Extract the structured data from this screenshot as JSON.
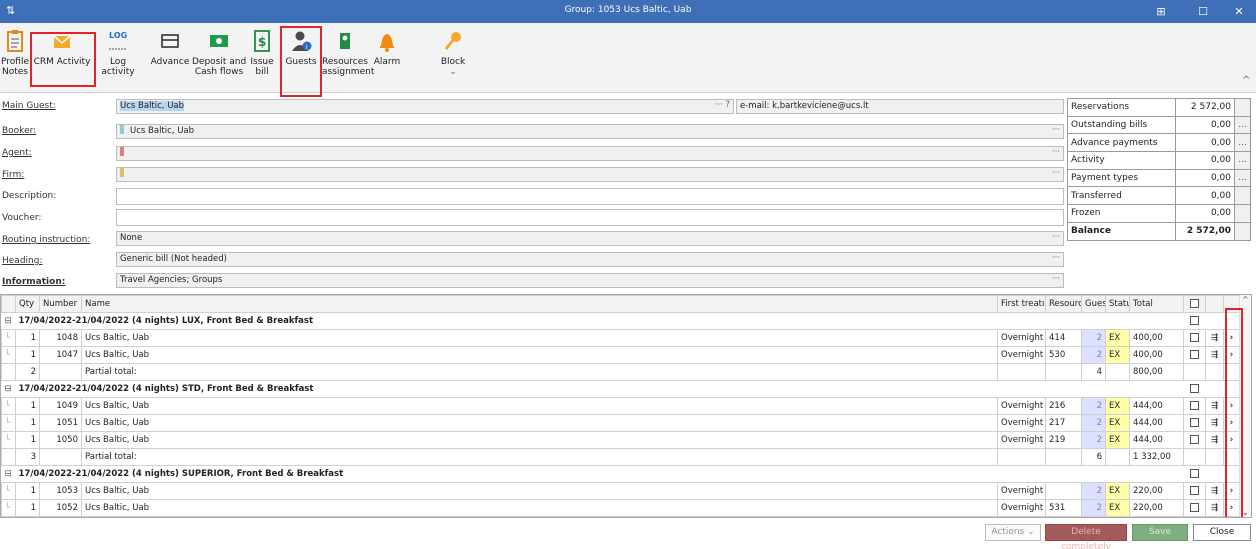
{
  "window": {
    "title": "Group: 1053 Ucs Baltic, Uab",
    "buttons": [
      "⊞",
      "☐",
      "✕"
    ]
  },
  "ribbon": {
    "items": [
      {
        "id": "profile-notes",
        "label": "Profile\nNotes",
        "icon": "clipboard-icon"
      },
      {
        "id": "crm-activity",
        "label": "CRM Activity",
        "icon": "envelope-icon"
      },
      {
        "id": "log-activity",
        "label": "Log activity",
        "icon": "log-icon",
        "icon_text": "LOG"
      },
      {
        "id": "advance",
        "label": "Advance",
        "icon": "card-icon"
      },
      {
        "id": "deposit",
        "label": "Deposit and\nCash flows",
        "icon": "cash-icon"
      },
      {
        "id": "issue-bill",
        "label": "Issue\nbill",
        "icon": "dollar-doc-icon"
      },
      {
        "id": "guests",
        "label": "Guests",
        "icon": "guest-icon"
      },
      {
        "id": "resources",
        "label": "Resources\nassignment",
        "icon": "hanger-icon"
      },
      {
        "id": "alarm",
        "label": "Alarm",
        "icon": "bell-icon"
      },
      {
        "id": "block",
        "label": "Block",
        "icon": "key-icon"
      }
    ],
    "collapse_glyph": "^",
    "block_chevron": "⌄"
  },
  "form": {
    "main_guest": {
      "label": "Main Guest:",
      "value": "Ucs Baltic, Uab",
      "suffix": "··· ?",
      "email": "e-mail: k.bartkeviciene@ucs.lt"
    },
    "booker": {
      "label": "Booker:",
      "value": "Ucs Baltic, Uab"
    },
    "agent": {
      "label": "Agent:",
      "value": ""
    },
    "firm": {
      "label": "Firm:",
      "value": ""
    },
    "description": {
      "label": "Description:",
      "value": ""
    },
    "voucher": {
      "label": "Voucher:",
      "value": ""
    },
    "routing": {
      "label": "Routing instruction:",
      "value": "None"
    },
    "heading": {
      "label": "Heading:",
      "value": "Generic bill (Not headed)"
    },
    "information": {
      "label": "Information:",
      "value": "Travel Agencies; Groups"
    },
    "dots": "···"
  },
  "summary": [
    {
      "label": "Reservations",
      "value": "2 572,00",
      "more": ""
    },
    {
      "label": "Outstanding bills",
      "value": "0,00",
      "more": "..."
    },
    {
      "label": "Advance payments",
      "value": "0,00",
      "more": "..."
    },
    {
      "label": "Activity",
      "value": "0,00",
      "more": "..."
    },
    {
      "label": "Payment types",
      "value": "0,00",
      "more": "..."
    },
    {
      "label": "Transferred",
      "value": "0,00",
      "more": ""
    },
    {
      "label": "Frozen",
      "value": "0,00",
      "more": ""
    },
    {
      "label": "Balance",
      "value": "2 572,00",
      "more": "",
      "bold": true
    }
  ],
  "grid": {
    "columns": {
      "qty": "Qty",
      "number": "Number",
      "name": "Name",
      "first": "First treatı",
      "resource": "Resourc",
      "guests": "Gues",
      "status": "Statu",
      "total": "Total"
    },
    "groups": [
      {
        "title": "17/04/2022-21/04/2022 (4 nights) LUX, Front Bed & Breakfast",
        "rows": [
          {
            "qty": "1",
            "number": "1048",
            "name": "Ucs Baltic, Uab",
            "first": "Overnight",
            "resource": "414",
            "guests": "2",
            "status": "EX",
            "total": "400,00"
          },
          {
            "qty": "1",
            "number": "1047",
            "name": "Ucs Baltic, Uab",
            "first": "Overnight",
            "resource": "530",
            "guests": "2",
            "status": "EX",
            "total": "400,00"
          }
        ],
        "partial": {
          "qty": "2",
          "label": "Partial total:",
          "guests": "4",
          "total": "800,00"
        }
      },
      {
        "title": "17/04/2022-21/04/2022 (4 nights) STD, Front Bed & Breakfast",
        "rows": [
          {
            "qty": "1",
            "number": "1049",
            "name": "Ucs Baltic, Uab",
            "first": "Overnight",
            "resource": "216",
            "guests": "2",
            "status": "EX",
            "total": "444,00"
          },
          {
            "qty": "1",
            "number": "1051",
            "name": "Ucs Baltic, Uab",
            "first": "Overnight",
            "resource": "217",
            "guests": "2",
            "status": "EX",
            "total": "444,00"
          },
          {
            "qty": "1",
            "number": "1050",
            "name": "Ucs Baltic, Uab",
            "first": "Overnight",
            "resource": "219",
            "guests": "2",
            "status": "EX",
            "total": "444,00"
          }
        ],
        "partial": {
          "qty": "3",
          "label": "Partial total:",
          "guests": "6",
          "total": "1 332,00"
        }
      },
      {
        "title": "17/04/2022-21/04/2022 (4 nights) SUPERIOR, Front Bed & Breakfast",
        "rows": [
          {
            "qty": "1",
            "number": "1053",
            "name": "Ucs Baltic, Uab",
            "first": "Overnight stay",
            "resource": "",
            "guests": "2",
            "status": "EX",
            "total": "220,00"
          },
          {
            "qty": "1",
            "number": "1052",
            "name": "Ucs Baltic, Uab",
            "first": "Overnight",
            "resource": "531",
            "guests": "2",
            "status": "EX",
            "total": "220,00"
          }
        ]
      }
    ],
    "row_action_glyph": "›",
    "split_glyph": "⇶"
  },
  "bottom": {
    "actions": "Actions",
    "actions_chevron": "⌄",
    "delete": "Delete completely",
    "save": "Save",
    "close": "Close"
  }
}
